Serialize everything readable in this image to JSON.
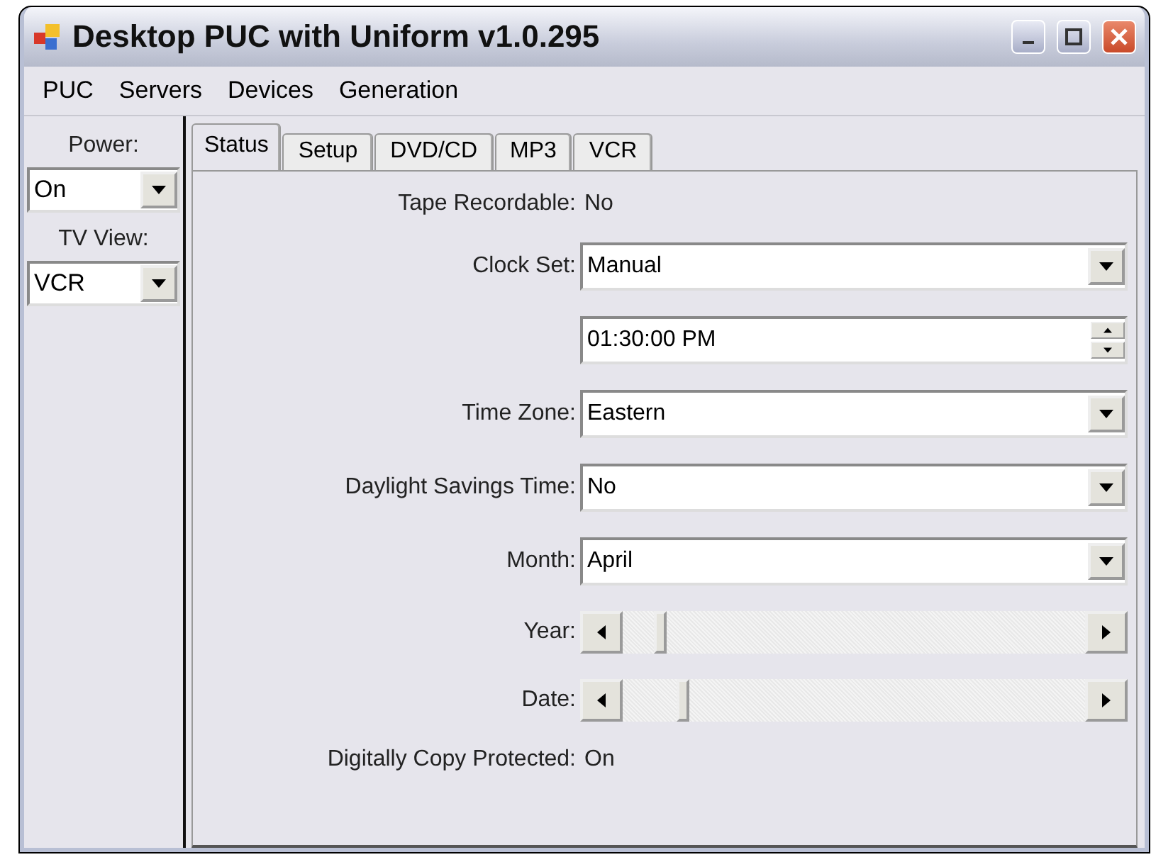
{
  "window": {
    "title": "Desktop PUC with Uniform v1.0.295"
  },
  "menu": [
    "PUC",
    "Servers",
    "Devices",
    "Generation"
  ],
  "sidebar": [
    {
      "label": "Power:",
      "value": "On"
    },
    {
      "label": "TV View:",
      "value": "VCR"
    }
  ],
  "tabs": [
    {
      "label": "Status",
      "selected": true
    },
    {
      "label": "Setup",
      "selected": false
    },
    {
      "label": "DVD/CD",
      "selected": false
    },
    {
      "label": "MP3",
      "selected": false
    },
    {
      "label": "VCR",
      "selected": false
    }
  ],
  "rows": [
    {
      "kind": "text",
      "label": "Tape Recordable:",
      "value": "No"
    },
    {
      "kind": "combo",
      "label": "Clock Set:",
      "value": "Manual"
    },
    {
      "kind": "spinner",
      "value": "01:30:00 PM"
    },
    {
      "kind": "combo",
      "label": "Time Zone:",
      "value": "Eastern"
    },
    {
      "kind": "combo",
      "label": "Daylight Savings Time:",
      "value": "No"
    },
    {
      "kind": "combo",
      "label": "Month:",
      "value": "April"
    },
    {
      "kind": "slider",
      "label": "Year:",
      "level": 0.07
    },
    {
      "kind": "slider",
      "label": "Date:",
      "level": 0.12
    },
    {
      "kind": "text",
      "label": "Digitally Copy Protected:",
      "value": "On"
    }
  ]
}
